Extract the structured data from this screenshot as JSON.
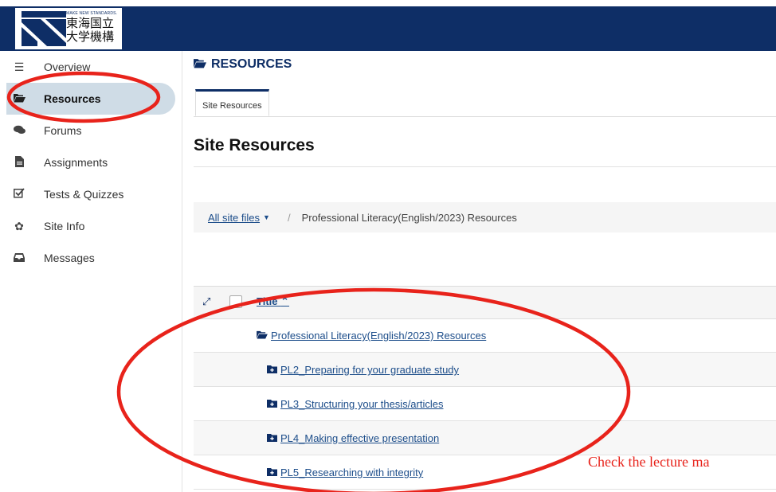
{
  "logo": {
    "slogan": "MAKE NEW STANDARDS.",
    "name_line1": "東海国立",
    "name_line2": "大学機構"
  },
  "sidebar": {
    "items": [
      {
        "label": "Overview",
        "icon": "list-icon"
      },
      {
        "label": "Resources",
        "icon": "folder-open-icon"
      },
      {
        "label": "Forums",
        "icon": "comments-icon"
      },
      {
        "label": "Assignments",
        "icon": "file-icon"
      },
      {
        "label": "Tests & Quizzes",
        "icon": "check-square-icon"
      },
      {
        "label": "Site Info",
        "icon": "gear-icon"
      },
      {
        "label": "Messages",
        "icon": "inbox-icon"
      }
    ],
    "active": "Resources"
  },
  "main": {
    "heading": "RESOURCES",
    "tab": "Site Resources",
    "section_title": "Site Resources",
    "breadcrumb": {
      "all_files": "All site files",
      "separator": "/",
      "current": "Professional Literacy(English/2023) Resources"
    },
    "table": {
      "title_header": "Title",
      "rows": [
        {
          "label": "Professional Literacy(English/2023) Resources"
        },
        {
          "label": "PL2_Preparing for your graduate study"
        },
        {
          "label": "PL3_Structuring your thesis/articles"
        },
        {
          "label": "PL4_Making effective presentation"
        },
        {
          "label": "PL5_Researching with integrity"
        }
      ]
    }
  },
  "annotation": {
    "text": "Check the lecture ma",
    "color": "#e8231b"
  },
  "colors": {
    "brand_navy": "#0e2e66",
    "active_bg": "#cfdce6",
    "link": "#1c4d8a"
  }
}
